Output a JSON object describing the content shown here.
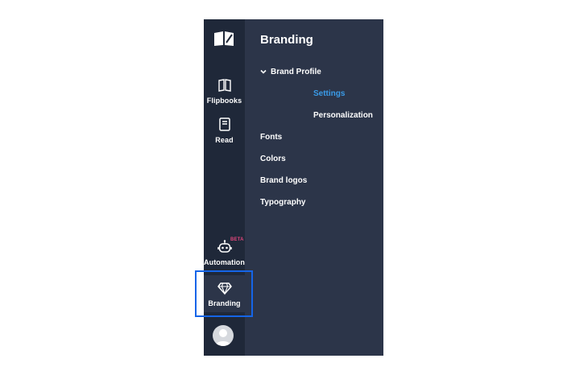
{
  "rail": {
    "items": [
      {
        "label": "Flipbooks",
        "icon": "book-open-icon"
      },
      {
        "label": "Read",
        "icon": "document-icon"
      },
      {
        "label": "Automation",
        "icon": "robot-icon",
        "badge": "BETA"
      },
      {
        "label": "Branding",
        "icon": "diamond-icon",
        "active": true
      }
    ]
  },
  "panel": {
    "title": "Branding",
    "menu": {
      "brand_profile": "Brand Profile",
      "settings": "Settings",
      "personalization": "Personalization",
      "fonts": "Fonts",
      "colors": "Colors",
      "brand_logos": "Brand logos",
      "typography": "Typography"
    }
  },
  "colors": {
    "rail_bg": "#1f2839",
    "panel_bg": "#2c3549",
    "accent": "#3a9be8",
    "beta": "#e0457b",
    "highlight": "#1565e8"
  }
}
